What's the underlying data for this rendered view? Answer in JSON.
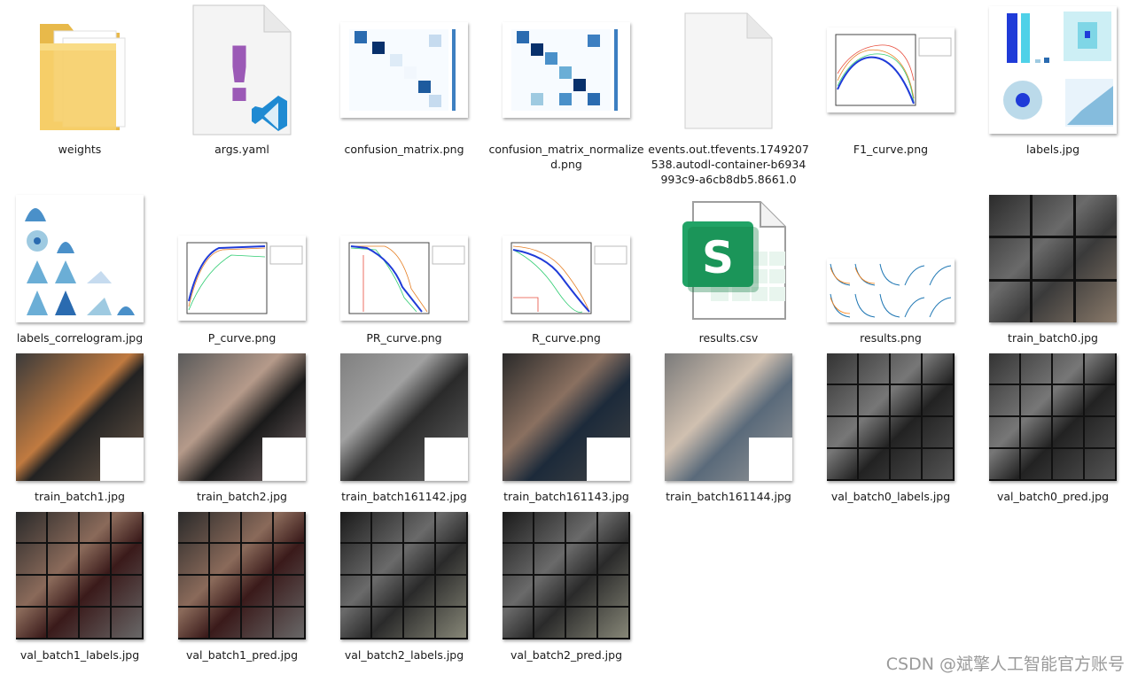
{
  "files": [
    {
      "name": "weights",
      "type": "folder"
    },
    {
      "name": "args.yaml",
      "type": "yaml"
    },
    {
      "name": "confusion_matrix.png",
      "type": "matrix"
    },
    {
      "name": "confusion_matrix_normalized.png",
      "type": "matrix"
    },
    {
      "name": "events.out.tfevents.1749207538.autodl-container-b6934993c9-a6cb8db5.8661.0",
      "type": "blank"
    },
    {
      "name": "F1_curve.png",
      "type": "curve"
    },
    {
      "name": "labels.jpg",
      "type": "labels"
    },
    {
      "name": "labels_correlogram.jpg",
      "type": "correlogram"
    },
    {
      "name": "P_curve.png",
      "type": "curve"
    },
    {
      "name": "PR_curve.png",
      "type": "curve"
    },
    {
      "name": "R_curve.png",
      "type": "curve"
    },
    {
      "name": "results.csv",
      "type": "csv"
    },
    {
      "name": "results.png",
      "type": "results"
    },
    {
      "name": "train_batch0.jpg",
      "type": "photo"
    },
    {
      "name": "train_batch1.jpg",
      "type": "photo"
    },
    {
      "name": "train_batch2.jpg",
      "type": "photo"
    },
    {
      "name": "train_batch161142.jpg",
      "type": "photo"
    },
    {
      "name": "train_batch161143.jpg",
      "type": "photo"
    },
    {
      "name": "train_batch161144.jpg",
      "type": "photo"
    },
    {
      "name": "val_batch0_labels.jpg",
      "type": "photo"
    },
    {
      "name": "val_batch0_pred.jpg",
      "type": "photo"
    },
    {
      "name": "val_batch1_labels.jpg",
      "type": "photo"
    },
    {
      "name": "val_batch1_pred.jpg",
      "type": "photo"
    },
    {
      "name": "val_batch2_labels.jpg",
      "type": "photo"
    },
    {
      "name": "val_batch2_pred.jpg",
      "type": "photo"
    }
  ],
  "icons": {
    "csv_letter": "S",
    "yaml_mark": "!"
  },
  "watermark": "CSDN @斌擎人工智能官方账号"
}
